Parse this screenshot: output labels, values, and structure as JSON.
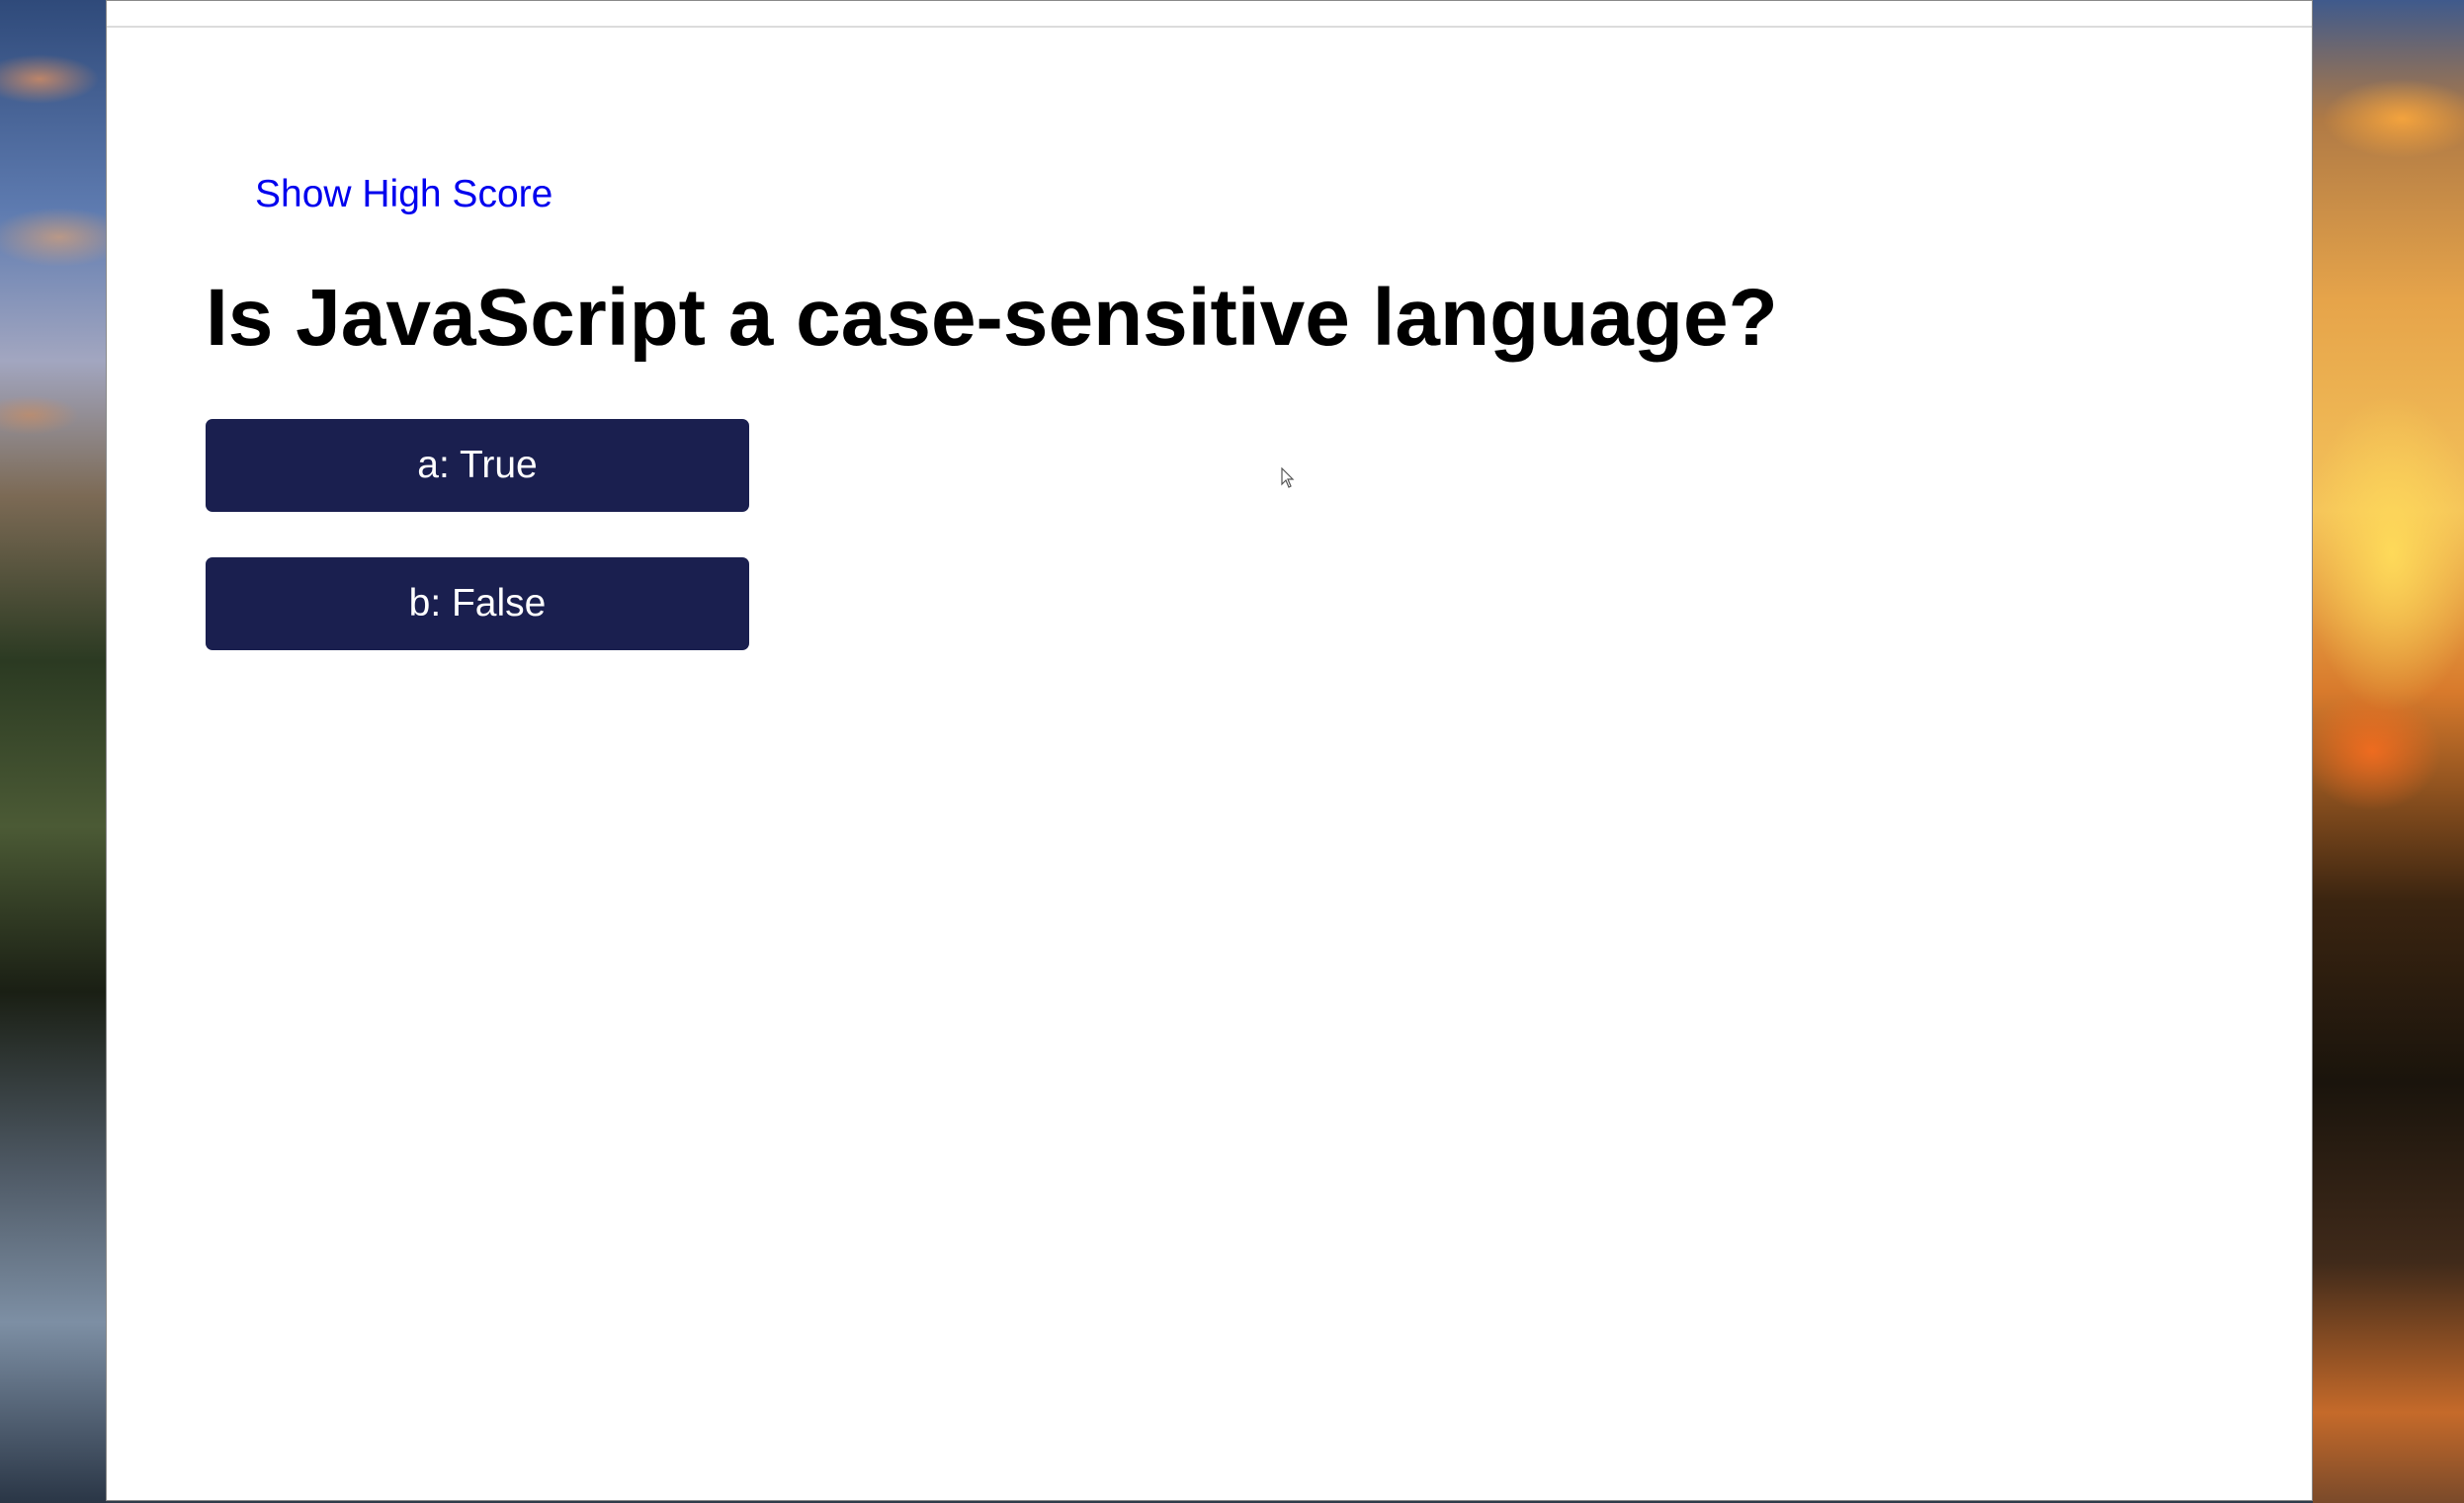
{
  "header": {
    "high_score_link": "Show High Score"
  },
  "quiz": {
    "question": "Is JavaScript a case-sensitive language?",
    "answers": [
      {
        "label": "a: True"
      },
      {
        "label": "b: False"
      }
    ]
  },
  "colors": {
    "answer_button_bg": "#1a1f4f",
    "link_color": "#0000ee"
  },
  "icons": {
    "cursor": "mouse-pointer-icon"
  }
}
